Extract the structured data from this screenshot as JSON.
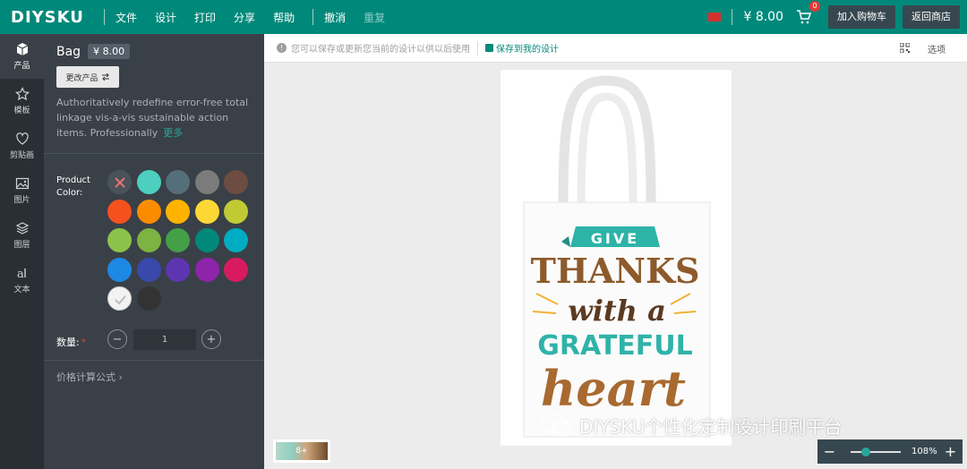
{
  "topbar": {
    "logo": "DIYSKU",
    "menu": [
      "文件",
      "设计",
      "打印",
      "分享",
      "帮助"
    ],
    "undo": "撤消",
    "redo": "重复",
    "price": "¥ 8.00",
    "cart_count": "0",
    "add_cart": "加入购物车",
    "back_store": "返回商店",
    "flag_color": "#d32f2f"
  },
  "rail": {
    "items": [
      {
        "label": "产品",
        "icon": "cube-icon"
      },
      {
        "label": "模板",
        "icon": "star-icon"
      },
      {
        "label": "剪贴画",
        "icon": "heart-icon"
      },
      {
        "label": "图片",
        "icon": "image-icon"
      },
      {
        "label": "图层",
        "icon": "layers-icon"
      },
      {
        "label": "文本",
        "icon": "text-icon"
      }
    ]
  },
  "panel": {
    "product_name": "Bag",
    "product_price": "¥ 8.00",
    "change_product": "更改产品",
    "description": "Authoritatively redefine error-free total linkage vis-a-vis sustainable action items. Professionally",
    "more": "更多",
    "color_label": "Product Color:",
    "colors": [
      "none",
      "#4dcfc0",
      "#546e7a",
      "#7b7b7b",
      "#6d4c41",
      "#f4511e",
      "#fb8c00",
      "#ffb300",
      "#fdd835",
      "#c0ca33",
      "#8bc34a",
      "#7cb342",
      "#43a047",
      "#00897b",
      "#00acc1",
      "#1e88e5",
      "#3949ab",
      "#5e35b1",
      "#8e24aa",
      "#d81b60",
      "#f2f2f2",
      "#333333"
    ],
    "qty_label": "数量:",
    "qty_required": "*",
    "qty_value": "1",
    "price_formula": "价格计算公式"
  },
  "canvas": {
    "hint": "您可以保存或更新您当前的设计以供以后使用",
    "save_design": "保存到我的设计",
    "options": "选项",
    "thumb_label": "8+",
    "zoom": "108%"
  },
  "design": {
    "line1": "GIVE",
    "line2": "THANKS",
    "line3": "with a",
    "line4": "GRATEFUL",
    "line5": "heart"
  },
  "watermark": "DIYSKU个性化定制设计印刷平台"
}
